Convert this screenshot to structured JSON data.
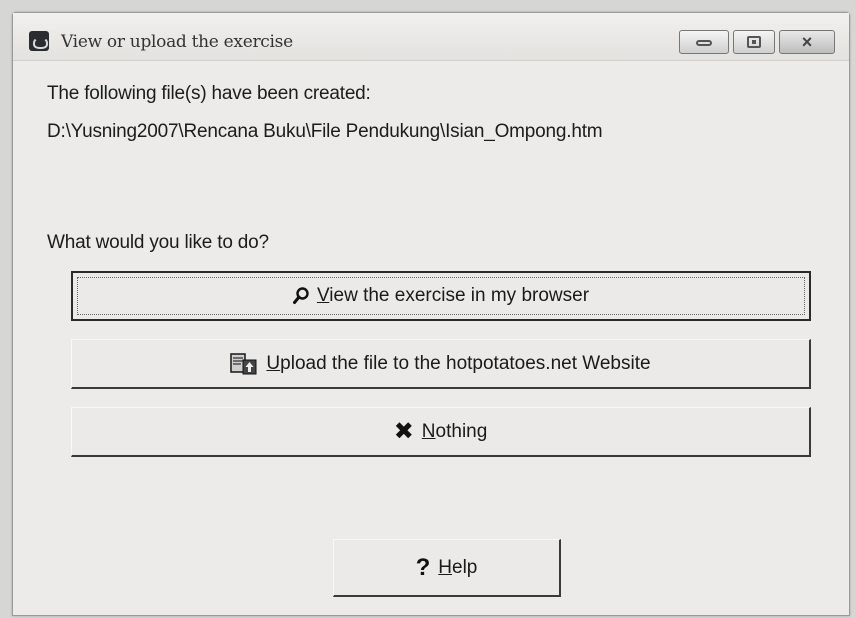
{
  "window": {
    "title": "View or upload the exercise",
    "controls": {
      "minimize_icon": "minimize-icon",
      "maximize_icon": "maximize-icon",
      "close_icon": "close-icon",
      "close_glyph": "×"
    }
  },
  "message": {
    "line1": "The following file(s) have been created:",
    "file_path": "D:\\Yusning2007\\Rencana Buku\\File Pendukung\\Isian_Ompong.htm",
    "prompt": "What would you like to do?"
  },
  "buttons": {
    "view": {
      "mnemonic": "V",
      "label_rest": "iew the exercise in my browser",
      "icon": "magnifier-icon"
    },
    "upload": {
      "mnemonic": "U",
      "label_rest": "pload the file to the hotpotatoes.net Website",
      "icon": "upload-icon"
    },
    "nothing": {
      "mnemonic": "N",
      "label_rest": "othing",
      "icon": "x-icon",
      "glyph": "✖"
    },
    "help": {
      "mnemonic": "H",
      "label_rest": "elp",
      "icon": "question-icon",
      "glyph": "?"
    }
  },
  "colors": {
    "window_bg": "#ecebea",
    "border_dark": "#3a3a3a"
  }
}
